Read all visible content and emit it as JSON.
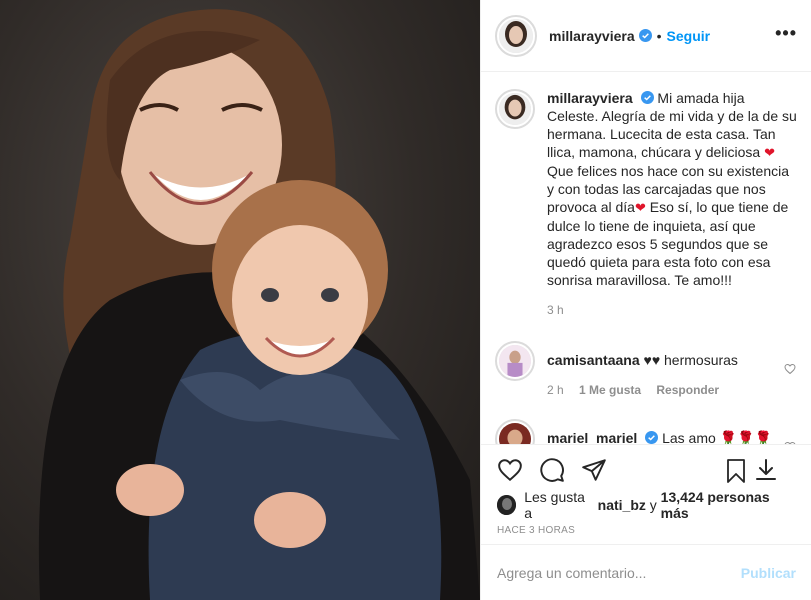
{
  "post": {
    "username": "millarayviera",
    "follow_label": "Seguir",
    "dot": "•",
    "more_label": "•••"
  },
  "caption": {
    "username": "millarayviera",
    "text_part1": "Mi amada hija Celeste. Alegría de mi vida y de la de su hermana. Lucecita de esta casa. Tan llica, mamona, chúcara y deliciosa ",
    "heart1": "❤",
    "text_part2": "Que felices nos hace con su existencia y con todas las carcajadas que nos provoca al día",
    "heart2": "❤",
    "text_part3": " Eso sí, lo que tiene de dulce lo tiene de inquieta, así que agradezco esos 5 segundos que se quedó quieta para esta foto con esa sonrisa maravillosa. Te amo!!!",
    "time": "3 h"
  },
  "comments": [
    {
      "username": "camisantaana",
      "text": "♥♥ hermosuras",
      "time": "2 h",
      "likes": "1 Me gusta",
      "reply": "Responder"
    },
    {
      "username": "mariel_mariel",
      "text": "Las amo 🌹🌹🌹"
    }
  ],
  "likes": {
    "prefix": "Les gusta a",
    "user": "nati_bz",
    "connector": "y",
    "count": "13,424 personas más"
  },
  "time_ago": "HACE 3 HORAS",
  "composer": {
    "placeholder": "Agrega un comentario...",
    "publish_label": "Publicar"
  },
  "colors": {
    "accent": "#0095f6",
    "verified": "#3897f0",
    "heart": "#e0152b",
    "muted": "#8e8e8e"
  }
}
